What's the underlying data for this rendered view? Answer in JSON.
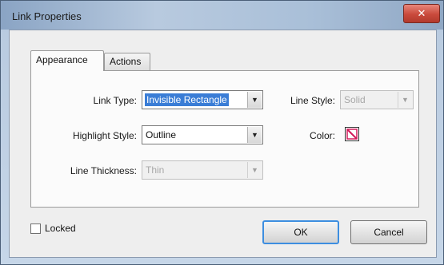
{
  "window": {
    "title": "Link Properties",
    "close_label": "✕"
  },
  "tabs": [
    {
      "label": "Appearance"
    },
    {
      "label": "Actions"
    }
  ],
  "form": {
    "link_type": {
      "label": "Link Type:",
      "value": "Invisible Rectangle"
    },
    "highlight_style": {
      "label": "Highlight Style:",
      "value": "Outline"
    },
    "line_thickness": {
      "label": "Line Thickness:",
      "value": "Thin"
    },
    "line_style": {
      "label": "Line Style:",
      "value": "Solid"
    },
    "color": {
      "label": "Color:"
    }
  },
  "locked": {
    "label": "Locked",
    "checked": false
  },
  "buttons": {
    "ok": "OK",
    "cancel": "Cancel"
  },
  "colors": {
    "selection": "#3a7dd6",
    "default_button_border": "#3d8ee0",
    "close_button": "#c94a3c"
  }
}
